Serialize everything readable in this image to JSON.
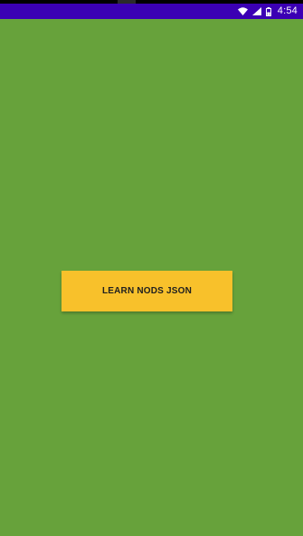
{
  "status_bar": {
    "time": "4:54",
    "icons": [
      "wifi-icon",
      "cellular-signal-icon",
      "battery-icon"
    ],
    "background": "#3b00b4"
  },
  "main": {
    "background": "#67a23b",
    "button_label": "LEARN NODS JSON",
    "button_color": "#f8c12b"
  }
}
